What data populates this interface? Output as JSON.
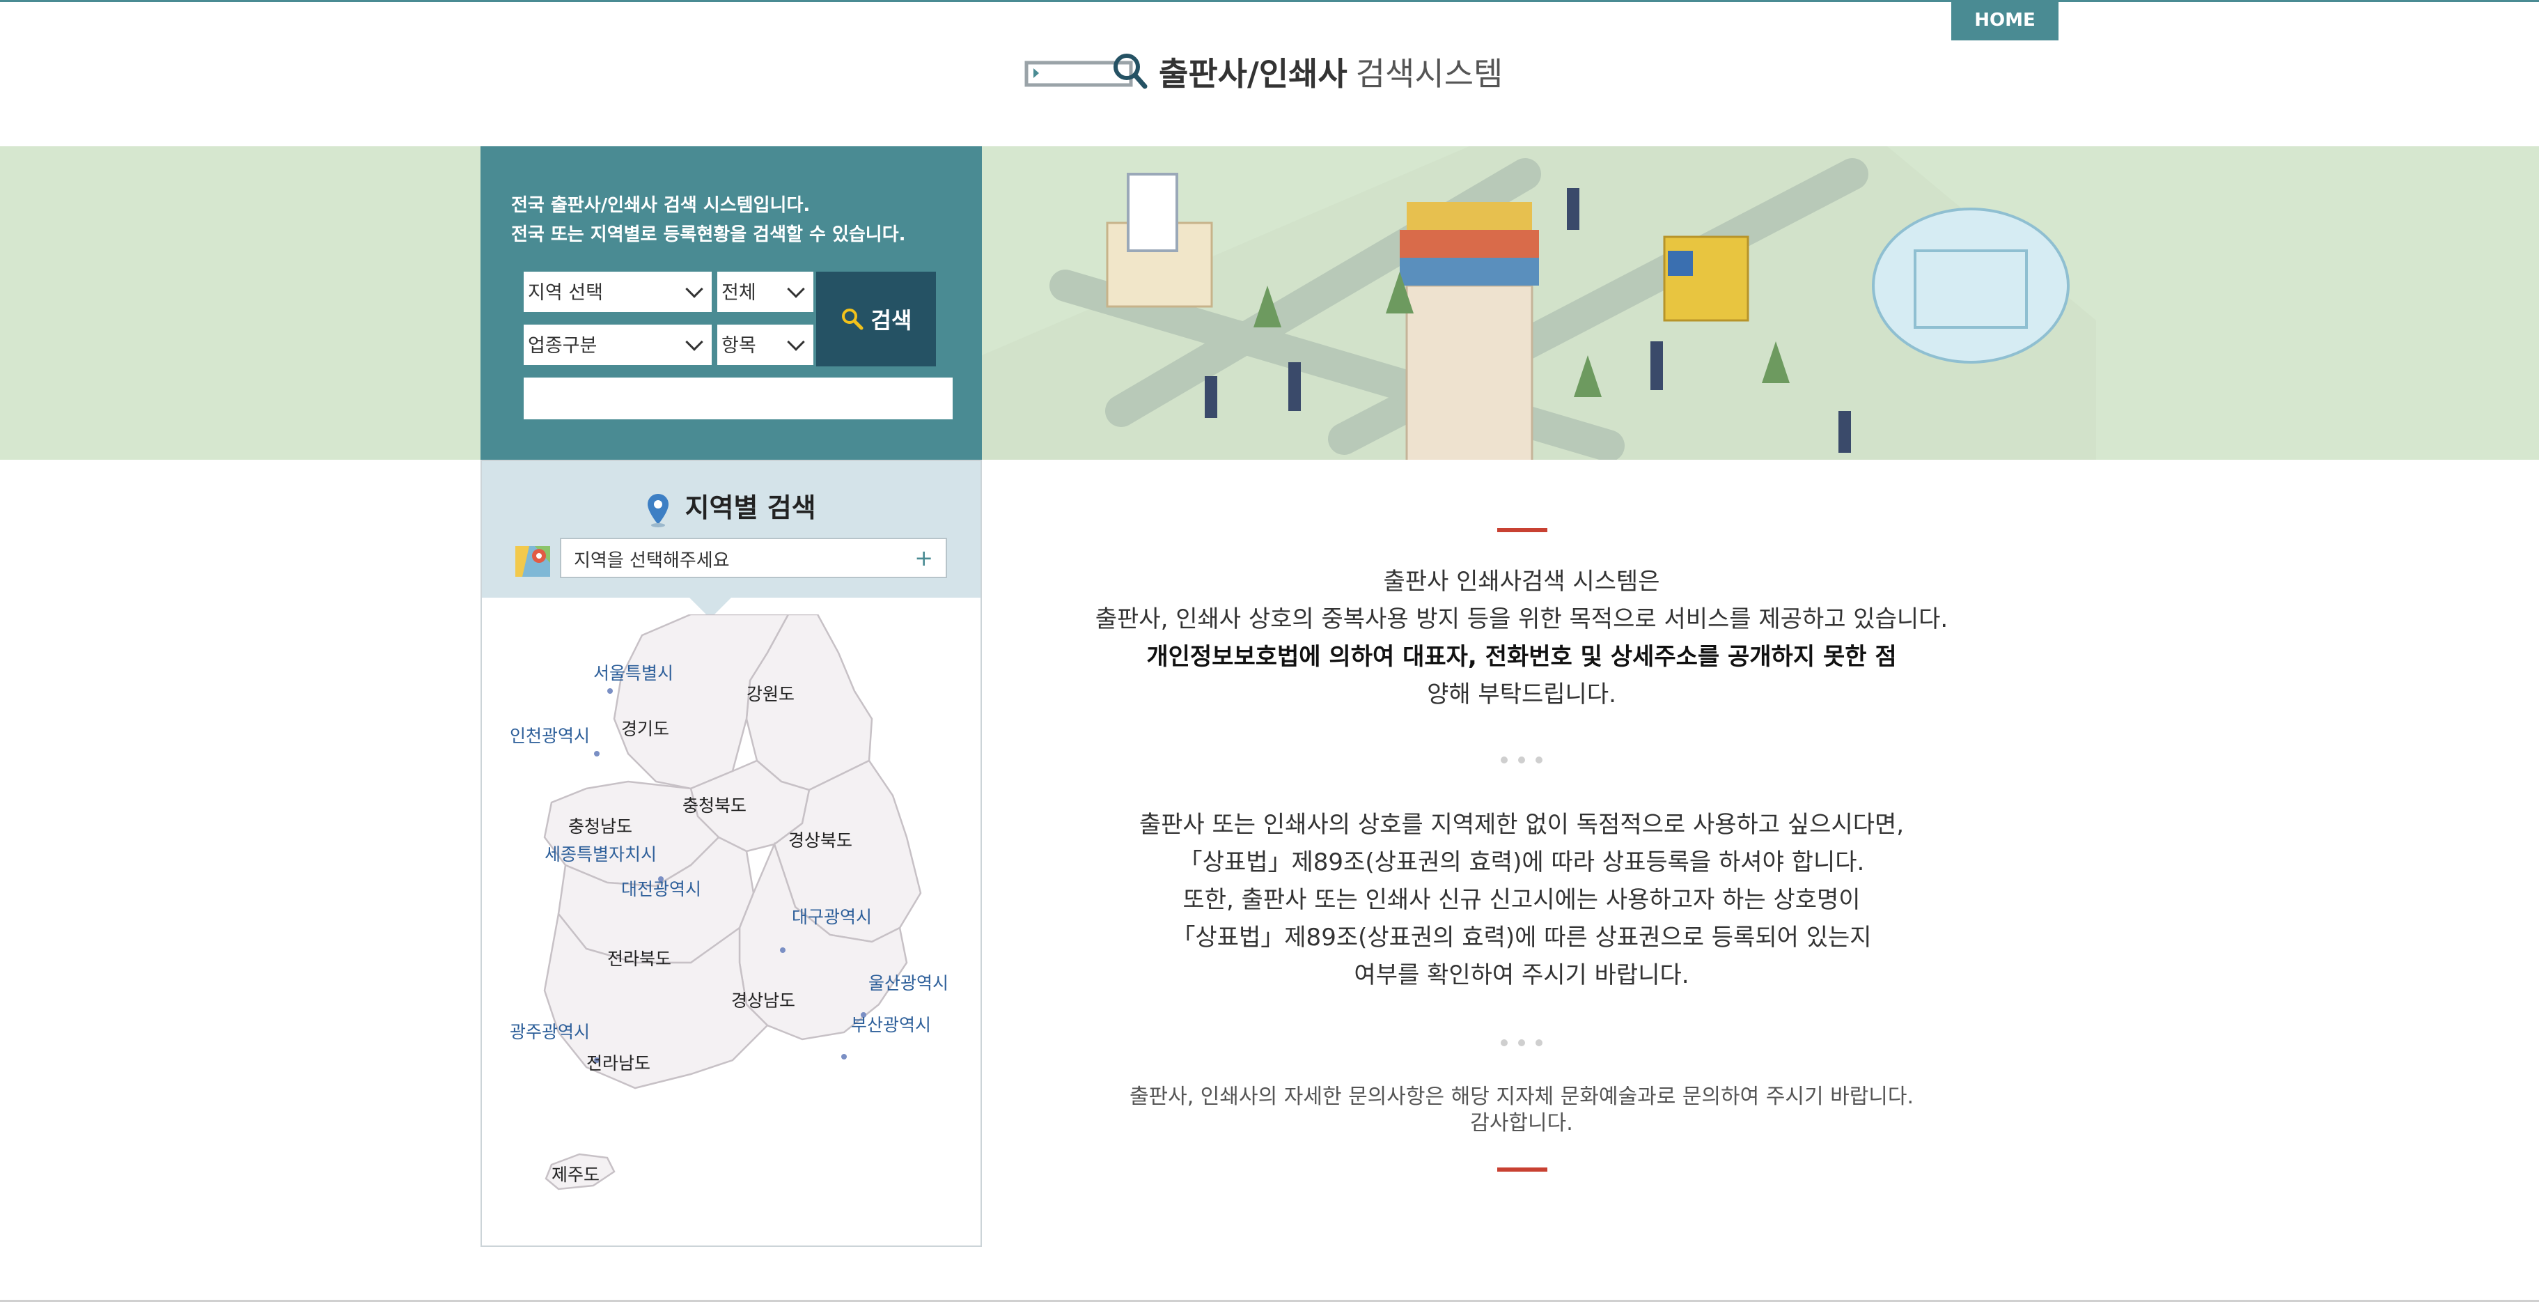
{
  "header": {
    "home_label": "HOME",
    "logo_strong": "출판사/인쇄사",
    "logo_light": "검색시스템"
  },
  "search_panel": {
    "intro_line1": "전국 출판사/인쇄사 검색 시스템입니다.",
    "intro_line2": "전국 또는 지역별로 등록현황을 검색할 수 있습니다.",
    "region_select": "지역 선택",
    "scope_select": "전체",
    "business_select": "업종구분",
    "field_select": "항목",
    "search_label": "검색",
    "keyword_value": ""
  },
  "region_search": {
    "title": "지역별 검색",
    "select_placeholder": "지역을 선택해주세요",
    "plus": "+"
  },
  "map_labels": {
    "seoul": "서울특별시",
    "gangwon": "강원도",
    "incheon": "인천광역시",
    "gyeonggi": "경기도",
    "chungbuk": "충청북도",
    "chungnam": "충청남도",
    "gyeongbuk": "경상북도",
    "sejong": "세종특별자치시",
    "daejeon": "대전광역시",
    "daegu": "대구광역시",
    "jeonbuk": "전라북도",
    "ulsan": "울산광역시",
    "gyeongnam": "경상남도",
    "gwangju": "광주광역시",
    "busan": "부산광역시",
    "jeonnam": "전라남도",
    "jeju": "제주도"
  },
  "info": {
    "p1_line1": "출판사 인쇄사검색 시스템은",
    "p1_line2": "출판사, 인쇄사 상호의 중복사용 방지 등을 위한 목적으로 서비스를 제공하고 있습니다.",
    "p1_line3": "개인정보보호법에 의하여 대표자, 전화번호 및 상세주소를 공개하지 못한 점",
    "p1_line4": "양해 부탁드립니다.",
    "p2_line1": "출판사 또는 인쇄사의 상호를 지역제한 없이 독점적으로 사용하고 싶으시다면,",
    "p2_line2": "「상표법」제89조(상표권의 효력)에 따라 상표등록을 하셔야 합니다.",
    "p2_line3": "또한, 출판사 또는 인쇄사 신규 신고시에는 사용하고자 하는 상호명이",
    "p2_line4": "「상표법」제89조(상표권의 효력)에 따른 상표권으로 등록되어 있는지",
    "p2_line5": "여부를 확인하여 주시기 바랍니다.",
    "p3_line1": "출판사, 인쇄사의 자세한 문의사항은 해당 지자체 문화예술과로 문의하여 주시기 바랍니다.",
    "p3_line2": "감사합니다."
  },
  "colors": {
    "teal": "#4a8b93",
    "navy": "#255264",
    "band": "#d6e7cf",
    "accent_red": "#c84132",
    "map_label_blue": "#2d5f9a"
  }
}
